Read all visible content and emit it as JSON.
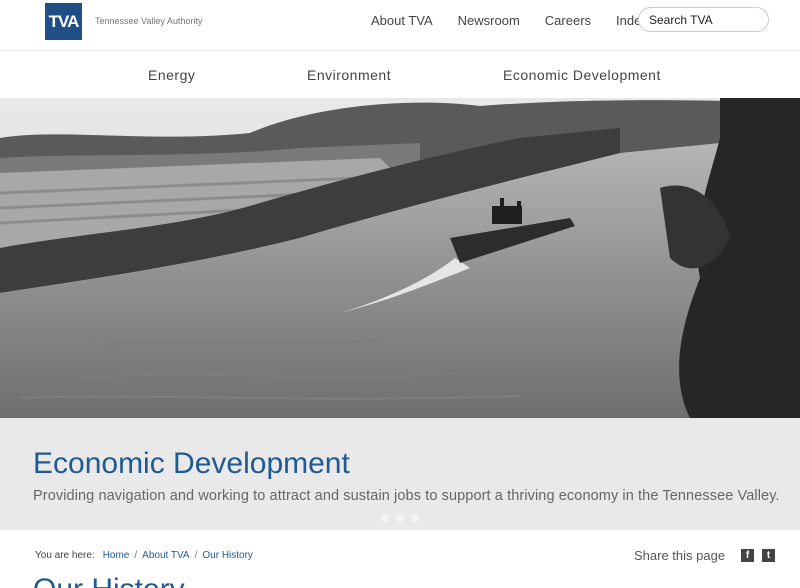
{
  "header": {
    "logo": "TVA",
    "org_name": "Tennessee Valley Authority",
    "nav": [
      "About TVA",
      "Newsroom",
      "Careers",
      "Index"
    ],
    "search_placeholder": "Search TVA"
  },
  "main_nav": [
    "Energy",
    "Environment",
    "Economic Development"
  ],
  "hero": {
    "title": "Economic Development",
    "subtitle": "Providing navigation and working to attract and sustain jobs to support a thriving economy in the Tennessee Valley.",
    "slides": 3
  },
  "breadcrumb": {
    "label": "You are here:",
    "items": [
      "Home",
      "About TVA",
      "Our History"
    ]
  },
  "share": {
    "label": "Share this page",
    "icons": [
      "facebook-icon",
      "twitter-icon"
    ]
  },
  "page_title": "Our History",
  "colors": {
    "brand": "#1f4f85",
    "heading": "#1f5a94",
    "caption_bg": "#e9e9e9"
  }
}
